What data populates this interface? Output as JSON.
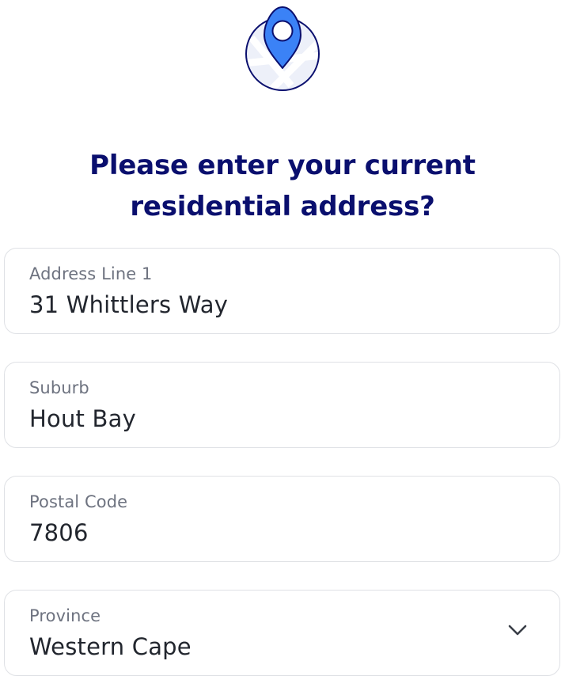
{
  "header": {
    "icon": "location-pin-icon",
    "title_line_1": "Please enter your current",
    "title_line_2": "residential address?"
  },
  "form": {
    "address_line_1": {
      "label": "Address Line 1",
      "value": "31 Whittlers Way"
    },
    "suburb": {
      "label": "Suburb",
      "value": "Hout Bay"
    },
    "postal_code": {
      "label": "Postal Code",
      "value": "7806"
    },
    "province": {
      "label": "Province",
      "value": "Western Cape",
      "icon": "chevron-down-icon"
    }
  },
  "colors": {
    "title": "#0a0f6e",
    "pin": "#3b82f6",
    "border": "#dfe1e5",
    "label": "#6e7380",
    "value": "#22262e"
  }
}
